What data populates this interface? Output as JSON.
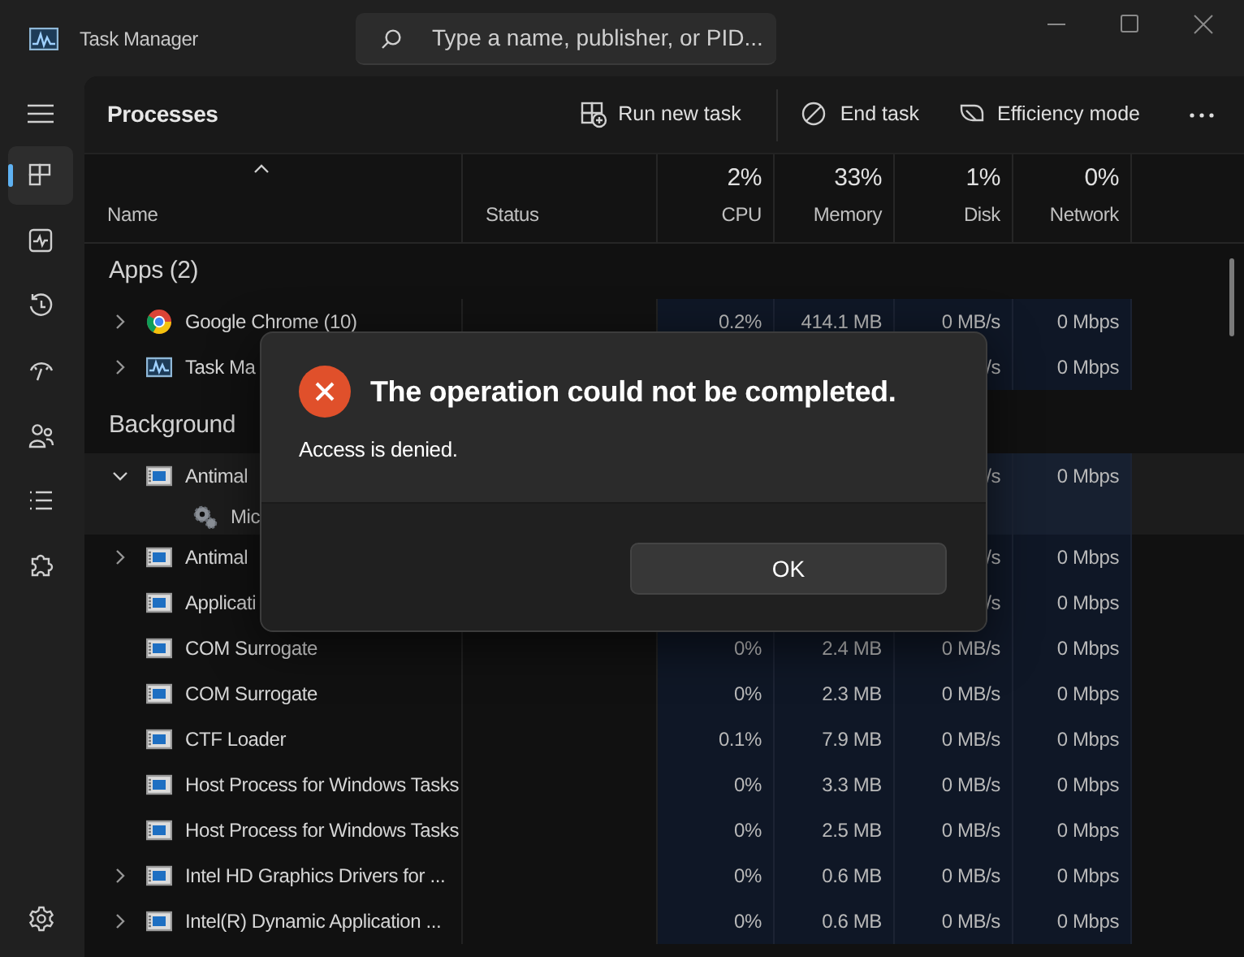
{
  "window": {
    "title": "Task Manager"
  },
  "search": {
    "placeholder": "Type a name, publisher, or PID..."
  },
  "sidebar": {
    "items": [
      {
        "selected": true
      },
      {
        "selected": false
      },
      {
        "selected": false
      },
      {
        "selected": false
      },
      {
        "selected": false
      },
      {
        "selected": false
      },
      {
        "selected": false
      }
    ]
  },
  "toolbar": {
    "title": "Processes",
    "actions": [
      {
        "label": "Run new task"
      },
      {
        "label": "End task"
      },
      {
        "label": "Efficiency mode"
      }
    ]
  },
  "table": {
    "columns": [
      {
        "label": "Name"
      },
      {
        "label": "Status"
      },
      {
        "percent": "2%",
        "label": "CPU"
      },
      {
        "percent": "33%",
        "label": "Memory"
      },
      {
        "percent": "1%",
        "label": "Disk"
      },
      {
        "percent": "0%",
        "label": "Network"
      }
    ],
    "sections": [
      {
        "title": "Apps (2)",
        "rows": [
          {
            "kind": "browser",
            "expanded": false,
            "name": "Google Chrome (10)",
            "cpu": "0.2%",
            "memory": "414.1 MB",
            "disk": "0 MB/s",
            "network": "0 Mbps"
          },
          {
            "kind": "monitor",
            "expanded": false,
            "name": "Task Ma",
            "disk": "/s",
            "network": "0 Mbps"
          }
        ]
      },
      {
        "title": "Background",
        "rows": [
          {
            "kind": "app",
            "expanded": true,
            "name": "Antimal",
            "disk": "/s",
            "network": "0 Mbps",
            "children": [
              {
                "kind": "service",
                "name": "Mic"
              }
            ]
          },
          {
            "kind": "app",
            "expanded": false,
            "name": "Antimal",
            "disk": "/s",
            "network": "0 Mbps"
          },
          {
            "kind": "app",
            "name": "Applicati",
            "disk": "/s",
            "network": "0 Mbps"
          },
          {
            "kind": "app",
            "name": "COM Surrogate",
            "cpu": "0%",
            "memory": "2.4 MB",
            "disk": "0 MB/s",
            "network": "0 Mbps"
          },
          {
            "kind": "app",
            "name": "COM Surrogate",
            "cpu": "0%",
            "memory": "2.3 MB",
            "disk": "0 MB/s",
            "network": "0 Mbps"
          },
          {
            "kind": "app",
            "name": "CTF Loader",
            "cpu": "0.1%",
            "memory": "7.9 MB",
            "disk": "0 MB/s",
            "network": "0 Mbps"
          },
          {
            "kind": "app",
            "name": "Host Process for Windows Tasks",
            "cpu": "0%",
            "memory": "3.3 MB",
            "disk": "0 MB/s",
            "network": "0 Mbps"
          },
          {
            "kind": "app",
            "name": "Host Process for Windows Tasks",
            "cpu": "0%",
            "memory": "2.5 MB",
            "disk": "0 MB/s",
            "network": "0 Mbps"
          },
          {
            "kind": "app",
            "expanded": false,
            "name": "Intel HD Graphics Drivers for ...",
            "cpu": "0%",
            "memory": "0.6 MB",
            "disk": "0 MB/s",
            "network": "0 Mbps"
          },
          {
            "kind": "app",
            "expanded": false,
            "name": "Intel(R) Dynamic Application ...",
            "cpu": "0%",
            "memory": "0.6 MB",
            "disk": "0 MB/s",
            "network": "0 Mbps"
          }
        ]
      }
    ]
  },
  "dialog": {
    "title": "The operation could not be completed.",
    "message": "Access is denied.",
    "button": "OK"
  }
}
